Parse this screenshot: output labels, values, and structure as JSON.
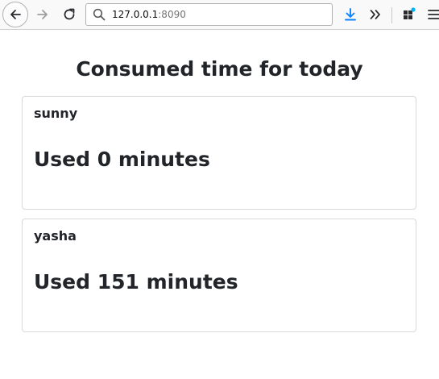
{
  "browser": {
    "url_host": "127.0.0.1",
    "url_port": ":8090",
    "icons": {
      "back": "back-arrow-icon",
      "forward": "forward-arrow-icon",
      "reload": "reload-icon",
      "search": "search-icon",
      "download": "download-icon",
      "overflow": "overflow-chevron-icon",
      "extensions": "extensions-icon",
      "menu": "hamburger-menu-icon"
    },
    "colors": {
      "download_accent": "#0a84ff",
      "extension_badge": "#00b3f4"
    }
  },
  "page": {
    "title": "Consumed time for today",
    "users": [
      {
        "name": "sunny",
        "usage": "Used 0 minutes"
      },
      {
        "name": "yasha",
        "usage": "Used 151 minutes"
      }
    ]
  }
}
